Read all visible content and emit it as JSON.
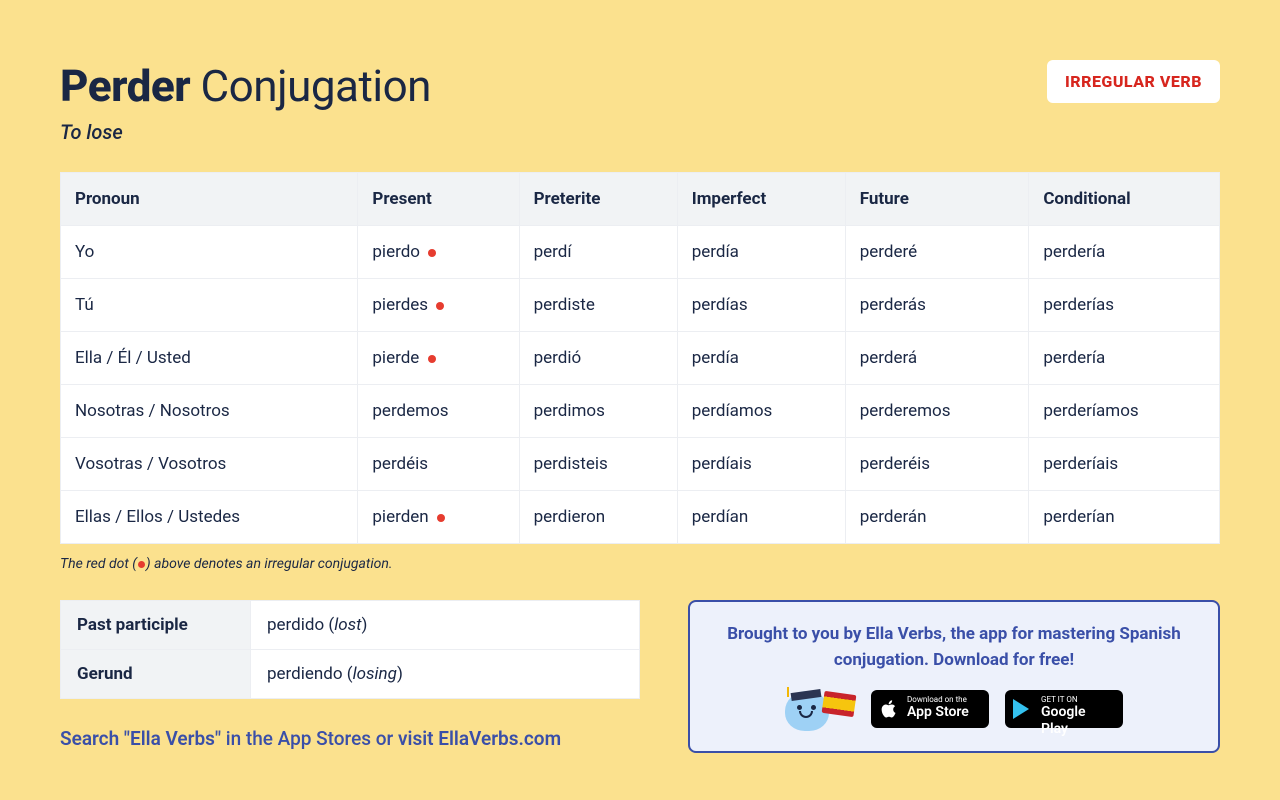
{
  "header": {
    "verb": "Perder",
    "title_suffix": "Conjugation",
    "translation": "To lose",
    "badge": "IRREGULAR VERB"
  },
  "table": {
    "headers": [
      "Pronoun",
      "Present",
      "Preterite",
      "Imperfect",
      "Future",
      "Conditional"
    ],
    "rows": [
      {
        "pronoun": "Yo",
        "cells": [
          {
            "text": "pierdo",
            "irr": true
          },
          {
            "text": "perdí"
          },
          {
            "text": "perdía"
          },
          {
            "text": "perderé"
          },
          {
            "text": "perdería"
          }
        ]
      },
      {
        "pronoun": "Tú",
        "cells": [
          {
            "text": "pierdes",
            "irr": true
          },
          {
            "text": "perdiste"
          },
          {
            "text": "perdías"
          },
          {
            "text": "perderás"
          },
          {
            "text": "perderías"
          }
        ]
      },
      {
        "pronoun": "Ella / Él / Usted",
        "cells": [
          {
            "text": "pierde",
            "irr": true
          },
          {
            "text": "perdió"
          },
          {
            "text": "perdía"
          },
          {
            "text": "perderá"
          },
          {
            "text": "perdería"
          }
        ]
      },
      {
        "pronoun": "Nosotras / Nosotros",
        "cells": [
          {
            "text": "perdemos"
          },
          {
            "text": "perdimos"
          },
          {
            "text": "perdíamos"
          },
          {
            "text": "perderemos"
          },
          {
            "text": "perderíamos"
          }
        ]
      },
      {
        "pronoun": "Vosotras / Vosotros",
        "cells": [
          {
            "text": "perdéis"
          },
          {
            "text": "perdisteis"
          },
          {
            "text": "perdíais"
          },
          {
            "text": "perderéis"
          },
          {
            "text": "perderíais"
          }
        ]
      },
      {
        "pronoun": "Ellas / Ellos / Ustedes",
        "cells": [
          {
            "text": "pierden",
            "irr": true
          },
          {
            "text": "perdieron"
          },
          {
            "text": "perdían"
          },
          {
            "text": "perderán"
          },
          {
            "text": "perderían"
          }
        ]
      }
    ]
  },
  "footnote": {
    "pre": "The red dot (",
    "post": ") above denotes an irregular conjugation."
  },
  "forms": {
    "past_participle": {
      "label": "Past participle",
      "value": "perdido",
      "trans": "lost"
    },
    "gerund": {
      "label": "Gerund",
      "value": "perdiendo",
      "trans": "losing"
    }
  },
  "search_line": {
    "a": "Search \"Ella Verbs\"",
    "b": " in the App Stores or ",
    "c": "visit EllaVerbs.com"
  },
  "promo": {
    "text": "Brought to you by Ella Verbs, the app for mastering Spanish conjugation. Download for free!",
    "appstore": {
      "small": "Download on the",
      "big": "App Store"
    },
    "gplay": {
      "small": "GET IT ON",
      "big": "Google Play"
    }
  }
}
